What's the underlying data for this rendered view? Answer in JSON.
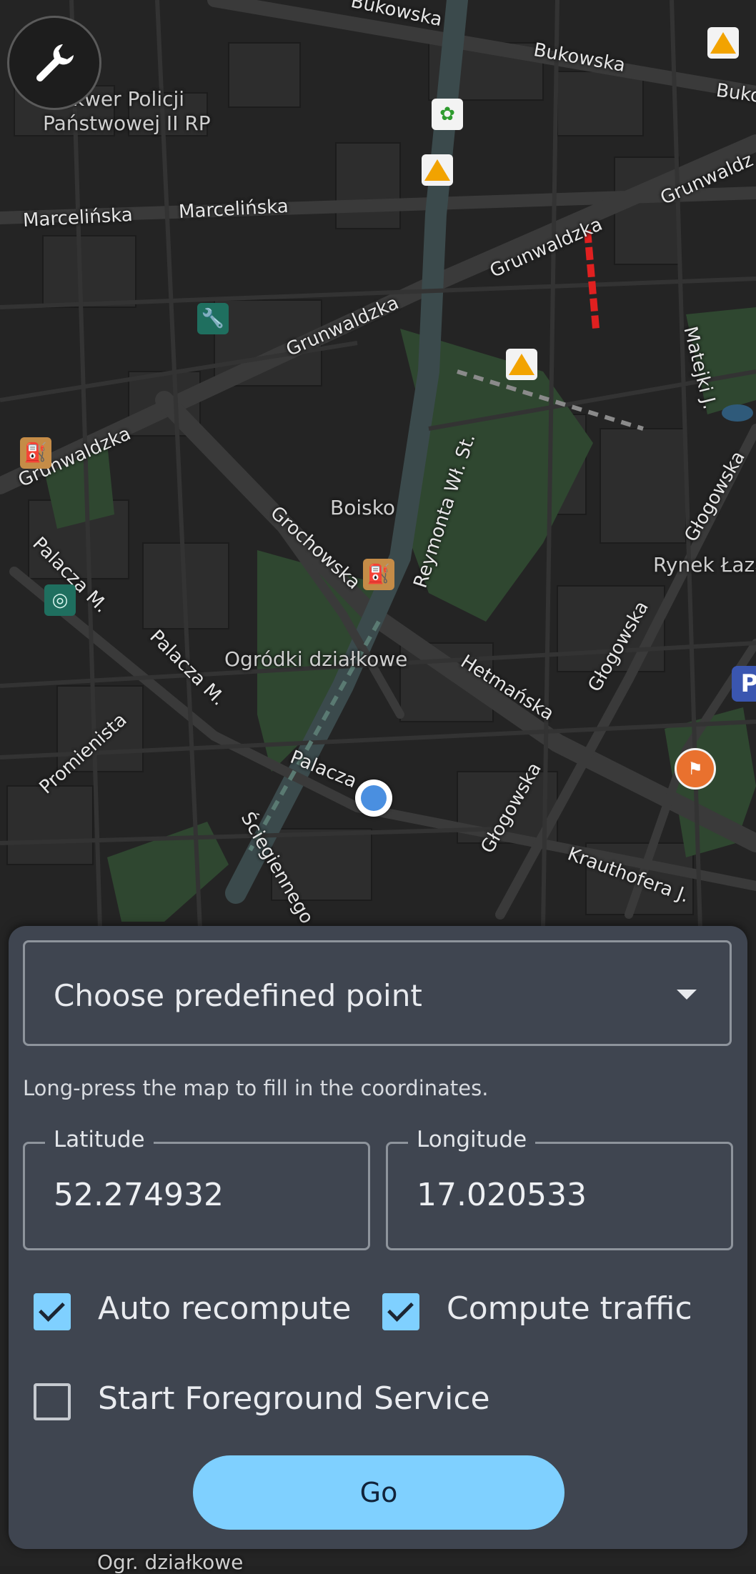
{
  "map": {
    "labels": {
      "bukowska_1": "Bukowska",
      "bukowska_2": "Bukowska",
      "bukowska_3": "Buko",
      "skwer": "Skwer Policji",
      "skwer2": "Państwowej II RP",
      "marcelinska_1": "Marcelińska",
      "marcelinska_2": "Marcelińska",
      "grunwaldzka_1": "Grunwaldzka",
      "grunwaldzka_2": "Grunwaldzka",
      "grunwaldzka_3": "Grunwaldz",
      "grunwaldzka_4": "Grunwaldzka",
      "matejki": "Matejki J.",
      "boisko": "Boisko",
      "reymonta": "Reymonta Wł. St.",
      "grochowska": "Grochowska",
      "glogowska_1": "Głogowska",
      "glogowska_2": "Głogowska",
      "glogowska_3": "Głogowska",
      "rynek": "Rynek Łaza",
      "palacza_1": "Palacza M.",
      "palacza_2": "Palacza M.",
      "palacza_3": "Palacza",
      "ogrodki": "Ogródki działkowe",
      "hetmanska": "Hetmańska",
      "promienista": "Promienista",
      "sciegiennego": "Ściegiennego",
      "krauthofera": "Krauthofera J.",
      "ogr_bottom": "Ogr. działkowe",
      "parking": "P"
    },
    "icons": {
      "tool": "wrench-icon",
      "location": "current-location-icon"
    }
  },
  "panel": {
    "dropdown_placeholder": "Choose predefined point",
    "hint": "Long-press the map to fill in the coordinates.",
    "latitude_label": "Latitude",
    "latitude_value": "52.274932",
    "longitude_label": "Longitude",
    "longitude_value": "17.020533",
    "auto_recompute_label": "Auto recompute",
    "auto_recompute_checked": true,
    "compute_traffic_label": "Compute traffic",
    "compute_traffic_checked": true,
    "foreground_label": "Start Foreground Service",
    "foreground_checked": false,
    "go_label": "Go"
  },
  "colors": {
    "accent": "#7fd0ff",
    "panel": "#3f4550",
    "map_bg": "#222222"
  }
}
